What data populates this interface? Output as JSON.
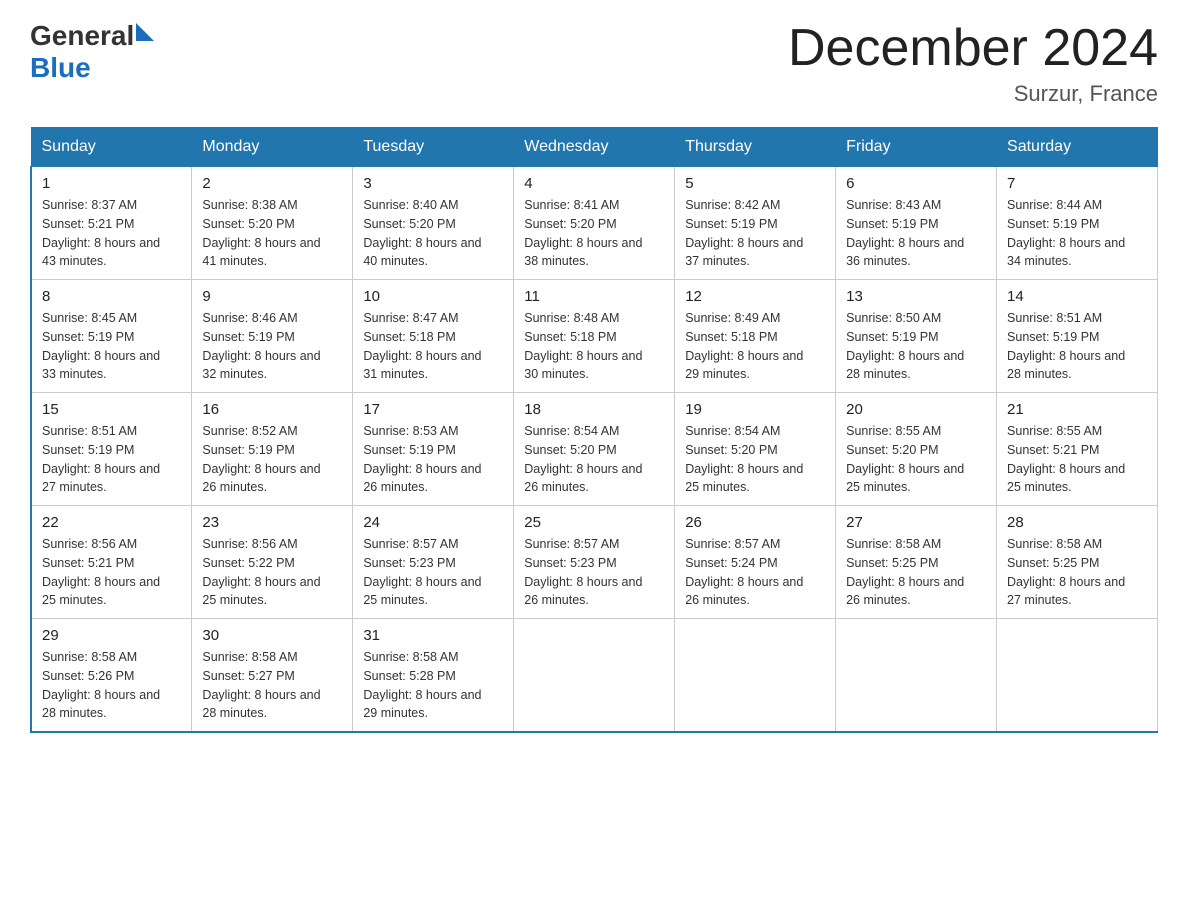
{
  "header": {
    "logo_general": "General",
    "logo_blue": "Blue",
    "title": "December 2024",
    "subtitle": "Surzur, France"
  },
  "days_of_week": [
    "Sunday",
    "Monday",
    "Tuesday",
    "Wednesday",
    "Thursday",
    "Friday",
    "Saturday"
  ],
  "weeks": [
    [
      {
        "day": "1",
        "sunrise": "8:37 AM",
        "sunset": "5:21 PM",
        "daylight": "8 hours and 43 minutes."
      },
      {
        "day": "2",
        "sunrise": "8:38 AM",
        "sunset": "5:20 PM",
        "daylight": "8 hours and 41 minutes."
      },
      {
        "day": "3",
        "sunrise": "8:40 AM",
        "sunset": "5:20 PM",
        "daylight": "8 hours and 40 minutes."
      },
      {
        "day": "4",
        "sunrise": "8:41 AM",
        "sunset": "5:20 PM",
        "daylight": "8 hours and 38 minutes."
      },
      {
        "day": "5",
        "sunrise": "8:42 AM",
        "sunset": "5:19 PM",
        "daylight": "8 hours and 37 minutes."
      },
      {
        "day": "6",
        "sunrise": "8:43 AM",
        "sunset": "5:19 PM",
        "daylight": "8 hours and 36 minutes."
      },
      {
        "day": "7",
        "sunrise": "8:44 AM",
        "sunset": "5:19 PM",
        "daylight": "8 hours and 34 minutes."
      }
    ],
    [
      {
        "day": "8",
        "sunrise": "8:45 AM",
        "sunset": "5:19 PM",
        "daylight": "8 hours and 33 minutes."
      },
      {
        "day": "9",
        "sunrise": "8:46 AM",
        "sunset": "5:19 PM",
        "daylight": "8 hours and 32 minutes."
      },
      {
        "day": "10",
        "sunrise": "8:47 AM",
        "sunset": "5:18 PM",
        "daylight": "8 hours and 31 minutes."
      },
      {
        "day": "11",
        "sunrise": "8:48 AM",
        "sunset": "5:18 PM",
        "daylight": "8 hours and 30 minutes."
      },
      {
        "day": "12",
        "sunrise": "8:49 AM",
        "sunset": "5:18 PM",
        "daylight": "8 hours and 29 minutes."
      },
      {
        "day": "13",
        "sunrise": "8:50 AM",
        "sunset": "5:19 PM",
        "daylight": "8 hours and 28 minutes."
      },
      {
        "day": "14",
        "sunrise": "8:51 AM",
        "sunset": "5:19 PM",
        "daylight": "8 hours and 28 minutes."
      }
    ],
    [
      {
        "day": "15",
        "sunrise": "8:51 AM",
        "sunset": "5:19 PM",
        "daylight": "8 hours and 27 minutes."
      },
      {
        "day": "16",
        "sunrise": "8:52 AM",
        "sunset": "5:19 PM",
        "daylight": "8 hours and 26 minutes."
      },
      {
        "day": "17",
        "sunrise": "8:53 AM",
        "sunset": "5:19 PM",
        "daylight": "8 hours and 26 minutes."
      },
      {
        "day": "18",
        "sunrise": "8:54 AM",
        "sunset": "5:20 PM",
        "daylight": "8 hours and 26 minutes."
      },
      {
        "day": "19",
        "sunrise": "8:54 AM",
        "sunset": "5:20 PM",
        "daylight": "8 hours and 25 minutes."
      },
      {
        "day": "20",
        "sunrise": "8:55 AM",
        "sunset": "5:20 PM",
        "daylight": "8 hours and 25 minutes."
      },
      {
        "day": "21",
        "sunrise": "8:55 AM",
        "sunset": "5:21 PM",
        "daylight": "8 hours and 25 minutes."
      }
    ],
    [
      {
        "day": "22",
        "sunrise": "8:56 AM",
        "sunset": "5:21 PM",
        "daylight": "8 hours and 25 minutes."
      },
      {
        "day": "23",
        "sunrise": "8:56 AM",
        "sunset": "5:22 PM",
        "daylight": "8 hours and 25 minutes."
      },
      {
        "day": "24",
        "sunrise": "8:57 AM",
        "sunset": "5:23 PM",
        "daylight": "8 hours and 25 minutes."
      },
      {
        "day": "25",
        "sunrise": "8:57 AM",
        "sunset": "5:23 PM",
        "daylight": "8 hours and 26 minutes."
      },
      {
        "day": "26",
        "sunrise": "8:57 AM",
        "sunset": "5:24 PM",
        "daylight": "8 hours and 26 minutes."
      },
      {
        "day": "27",
        "sunrise": "8:58 AM",
        "sunset": "5:25 PM",
        "daylight": "8 hours and 26 minutes."
      },
      {
        "day": "28",
        "sunrise": "8:58 AM",
        "sunset": "5:25 PM",
        "daylight": "8 hours and 27 minutes."
      }
    ],
    [
      {
        "day": "29",
        "sunrise": "8:58 AM",
        "sunset": "5:26 PM",
        "daylight": "8 hours and 28 minutes."
      },
      {
        "day": "30",
        "sunrise": "8:58 AM",
        "sunset": "5:27 PM",
        "daylight": "8 hours and 28 minutes."
      },
      {
        "day": "31",
        "sunrise": "8:58 AM",
        "sunset": "5:28 PM",
        "daylight": "8 hours and 29 minutes."
      },
      null,
      null,
      null,
      null
    ]
  ]
}
